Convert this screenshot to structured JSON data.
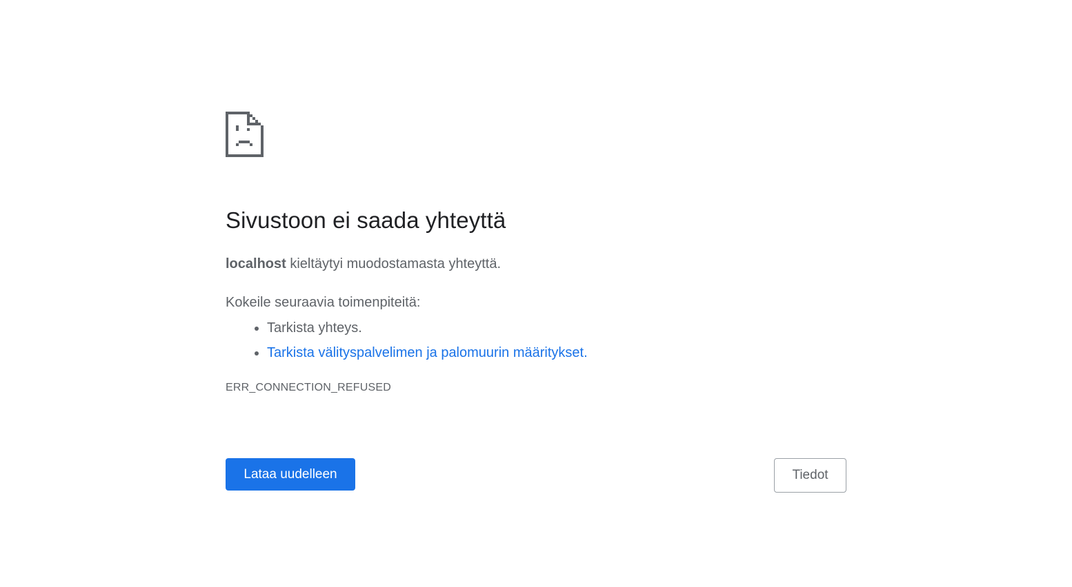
{
  "icon": "sad-page-icon",
  "heading": "Sivustoon ei saada yhteyttä",
  "description": {
    "host": "localhost",
    "text": " kieltäytyi muodostamasta yhteyttä."
  },
  "suggestions": {
    "heading": "Kokeile seuraavia toimenpiteitä:",
    "items": [
      {
        "label": "Tarkista yhteys.",
        "is_link": false
      },
      {
        "label": "Tarkista välityspalvelimen ja palomuurin määritykset.",
        "is_link": true
      }
    ]
  },
  "error_code": "ERR_CONNECTION_REFUSED",
  "buttons": {
    "reload_label": "Lataa uudelleen",
    "details_label": "Tiedot"
  },
  "colors": {
    "accent": "#1a73e8",
    "text_primary": "#202124",
    "text_secondary": "#5f6368"
  }
}
